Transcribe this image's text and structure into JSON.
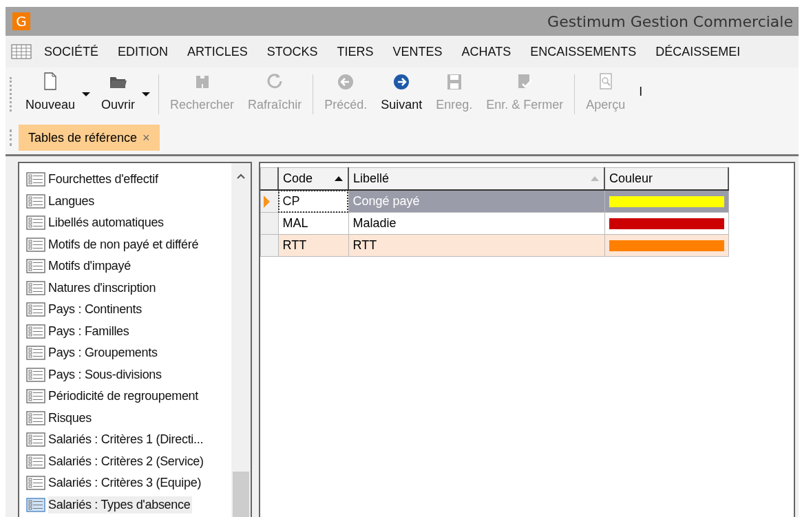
{
  "window": {
    "logo": "G",
    "title": "Gestimum Gestion Commerciale"
  },
  "menu": [
    {
      "label": "SOCIÉTÉ"
    },
    {
      "label": "EDITION"
    },
    {
      "label": "ARTICLES"
    },
    {
      "label": "STOCKS"
    },
    {
      "label": "TIERS"
    },
    {
      "label": "VENTES"
    },
    {
      "label": "ACHATS"
    },
    {
      "label": "ENCAISSEMENTS"
    },
    {
      "label": "DÉCAISSEMEI"
    }
  ],
  "toolbar": [
    [
      {
        "label": "Nouveau",
        "disabled": false,
        "has_menu": true
      },
      {
        "label": "Ouvrir",
        "disabled": false,
        "has_menu": true
      }
    ],
    [
      {
        "label": "Rechercher",
        "disabled": true,
        "has_menu": false
      },
      {
        "label": "Rafraîchir",
        "disabled": true,
        "has_menu": false
      }
    ],
    [
      {
        "label": "Précéd.",
        "disabled": true,
        "has_menu": false
      },
      {
        "label": "Suivant",
        "disabled": false,
        "has_menu": false
      },
      {
        "label": "Enreg.",
        "disabled": true,
        "has_menu": false
      },
      {
        "label": "Enr. & Fermer",
        "disabled": true,
        "has_menu": false
      }
    ],
    [
      {
        "label": "Aperçu",
        "disabled": true,
        "has_menu": false
      },
      {
        "label": "I",
        "disabled": false,
        "has_menu": false
      }
    ]
  ],
  "tabs": [
    {
      "label": "Tables de référence",
      "close": "×",
      "selected": true
    }
  ],
  "sidebar": {
    "items": [
      {
        "label": "Fourchettes d'effectif",
        "selected": false
      },
      {
        "label": "Langues",
        "selected": false
      },
      {
        "label": "Libellés automatiques",
        "selected": false
      },
      {
        "label": "Motifs de non payé et différé",
        "selected": false
      },
      {
        "label": "Motifs d'impayé",
        "selected": false
      },
      {
        "label": "Natures d'inscription",
        "selected": false
      },
      {
        "label": "Pays : Continents",
        "selected": false
      },
      {
        "label": "Pays : Familles",
        "selected": false
      },
      {
        "label": "Pays : Groupements",
        "selected": false
      },
      {
        "label": "Pays : Sous-divisions",
        "selected": false
      },
      {
        "label": "Périodicité de regroupement",
        "selected": false
      },
      {
        "label": "Risques",
        "selected": false
      },
      {
        "label": "Salariés : Critères 1 (Directi...",
        "selected": false
      },
      {
        "label": "Salariés : Critères 2 (Service)",
        "selected": false
      },
      {
        "label": "Salariés : Critères 3 (Equipe)",
        "selected": false
      },
      {
        "label": "Salariés : Types d'absence",
        "selected": true
      }
    ]
  },
  "table": {
    "columns": [
      {
        "label": "Code",
        "sorted": true,
        "sort_active": true
      },
      {
        "label": "Libellé",
        "sorted": true,
        "sort_active": false
      },
      {
        "label": "Couleur",
        "sorted": false
      }
    ],
    "rows": [
      {
        "code": "CP",
        "label": "Congé payé",
        "color": "#ffff00",
        "selected": true,
        "hovered": false
      },
      {
        "code": "MAL",
        "label": "Maladie",
        "color": "#cc0000",
        "selected": false,
        "hovered": false
      },
      {
        "code": "RTT",
        "label": "RTT",
        "color": "#ff8000",
        "selected": false,
        "hovered": true
      }
    ]
  }
}
